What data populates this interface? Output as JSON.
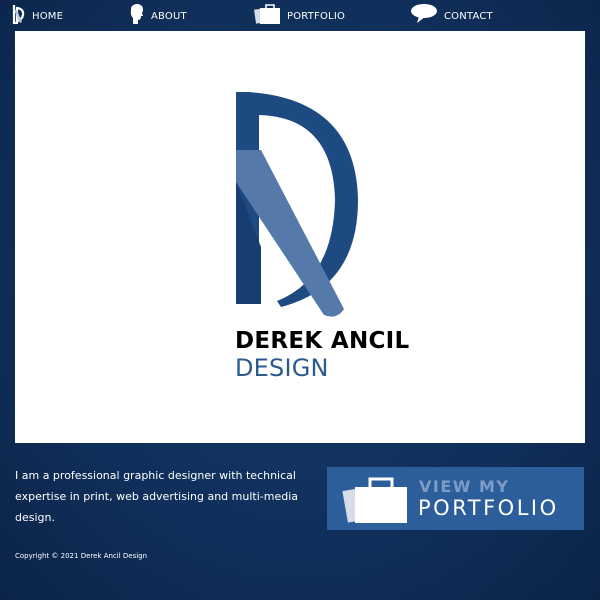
{
  "nav": {
    "items": [
      {
        "label": "HOME",
        "icon": "logo-icon"
      },
      {
        "label": "ABOUT",
        "icon": "head-icon"
      },
      {
        "label": "PORTFOLIO",
        "icon": "briefcase-icon"
      },
      {
        "label": "CONTACT",
        "icon": "speech-bubble-icon"
      }
    ]
  },
  "hero": {
    "brand_name": "DEREK ANCIL",
    "brand_sub": "DESIGN"
  },
  "intro": {
    "text": "I am a professional graphic designer with technical expertise in print, web advertising and multi-media design."
  },
  "cta": {
    "line1": "VIEW MY",
    "line2": "PORTFOLIO",
    "icon": "briefcase-icon"
  },
  "footer": {
    "copyright": "Copyright © 2021 Derek Ancil Design"
  },
  "colors": {
    "background": "#10305c",
    "logo_dark": "#1e4a82",
    "logo_light": "#5579a8",
    "cta_bg": "#2d5e9c",
    "cta_accent": "#7d9dc6",
    "brand_sub": "#2a5a90"
  }
}
